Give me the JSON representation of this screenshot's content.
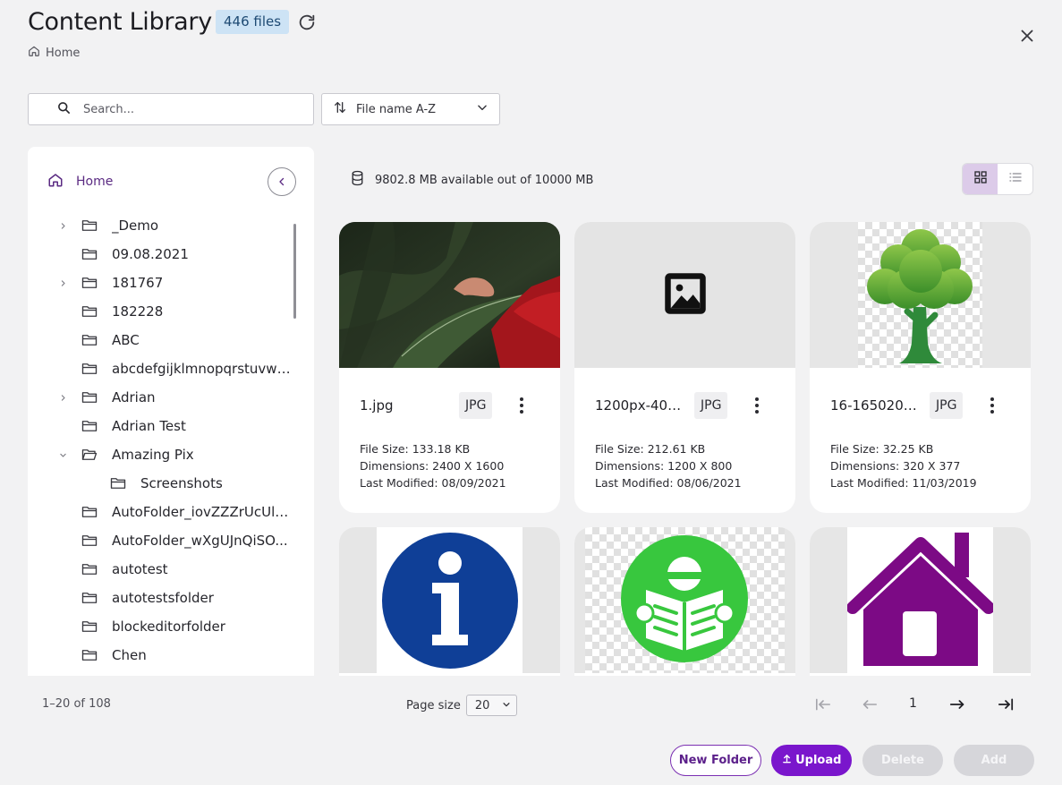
{
  "header": {
    "title": "Content Library",
    "files_badge": "446 files",
    "breadcrumb": "Home"
  },
  "search": {
    "placeholder": "Search..."
  },
  "sort": {
    "label": "File name A-Z"
  },
  "sidebar": {
    "home_label": "Home",
    "items": [
      {
        "label": "_Demo",
        "expandable": true,
        "expanded": false,
        "level": 0
      },
      {
        "label": "09.08.2021",
        "expandable": false,
        "level": 0
      },
      {
        "label": "181767",
        "expandable": true,
        "expanded": false,
        "level": 0
      },
      {
        "label": "182228",
        "expandable": false,
        "level": 0
      },
      {
        "label": "ABC",
        "expandable": false,
        "level": 0
      },
      {
        "label": "abcdefgijklmnopqrstuvwx...",
        "expandable": false,
        "level": 0
      },
      {
        "label": "Adrian",
        "expandable": true,
        "expanded": false,
        "level": 0
      },
      {
        "label": "Adrian Test",
        "expandable": false,
        "level": 0
      },
      {
        "label": "Amazing Pix",
        "expandable": true,
        "expanded": true,
        "level": 0
      },
      {
        "label": "Screenshots",
        "expandable": false,
        "level": 1
      },
      {
        "label": "AutoFolder_iovZZZrUcUlR...",
        "expandable": false,
        "level": 0
      },
      {
        "label": "AutoFolder_wXgUJnQiSO...",
        "expandable": false,
        "level": 0
      },
      {
        "label": "autotest",
        "expandable": false,
        "level": 0
      },
      {
        "label": "autotestsfolder",
        "expandable": false,
        "level": 0
      },
      {
        "label": "blockeditorfolder",
        "expandable": false,
        "level": 0
      },
      {
        "label": "Chen",
        "expandable": false,
        "level": 0
      }
    ]
  },
  "storage": {
    "text": "9802.8 MB available out of 10000 MB"
  },
  "view": {
    "active": "grid"
  },
  "files": [
    {
      "name": "1.jpg",
      "type": "JPG",
      "size": "File Size: 133.18 KB",
      "dimensions": "Dimensions: 2400 X 1600",
      "modified": "Last Modified: 08/09/2021",
      "thumb": "photo-leaf"
    },
    {
      "name": "1200px-401...",
      "type": "JPG",
      "size": "File Size: 212.61 KB",
      "dimensions": "Dimensions: 1200 X 800",
      "modified": "Last Modified: 08/06/2021",
      "thumb": "image-placeholder-icon"
    },
    {
      "name": "16-165020_...",
      "type": "JPG",
      "size": "File Size: 32.25 KB",
      "dimensions": "Dimensions: 320 X 377",
      "modified": "Last Modified: 11/03/2019",
      "thumb": "tree-icon"
    },
    {
      "thumb": "info-icon"
    },
    {
      "thumb": "reading-book-icon"
    },
    {
      "thumb": "house-icon"
    }
  ],
  "pagination": {
    "range": "1–20 of 108",
    "page_size_label": "Page size",
    "page_size": "20",
    "current_page": "1"
  },
  "actions": {
    "new_folder": "New Folder",
    "upload": "Upload",
    "delete": "Delete",
    "add": "Add"
  },
  "colors": {
    "accent": "#7a16cc",
    "accent_dark": "#5b1f8a",
    "badge_bg": "#cde3f5",
    "disabled": "#d6d6da"
  }
}
